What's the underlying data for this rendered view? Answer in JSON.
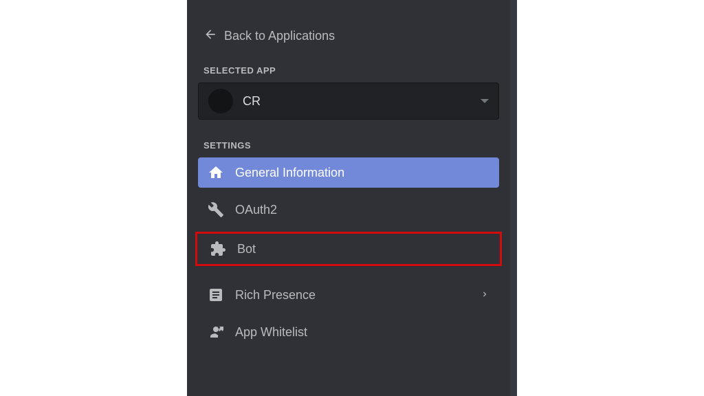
{
  "back_link": "Back to Applications",
  "selected_app_label": "SELECTED APP",
  "selected_app_name": "CR",
  "settings_label": "SETTINGS",
  "nav": {
    "general": "General Information",
    "oauth2": "OAuth2",
    "bot": "Bot",
    "rich_presence": "Rich Presence",
    "app_whitelist": "App Whitelist"
  }
}
